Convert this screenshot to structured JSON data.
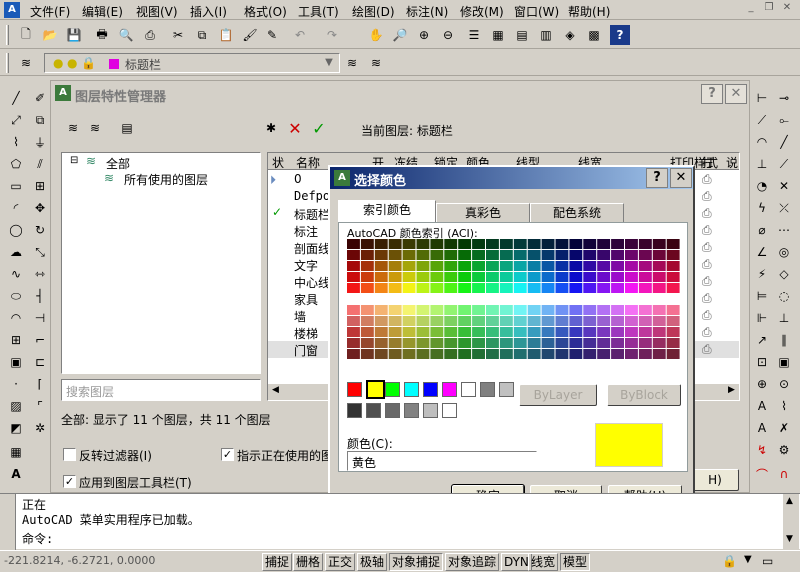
{
  "menubar": {
    "items": [
      "文件(F)",
      "编辑(E)",
      "视图(V)",
      "插入(I)",
      "格式(O)",
      "工具(T)",
      "绘图(D)",
      "标注(N)",
      "修改(M)",
      "窗口(W)",
      "帮助(H)"
    ]
  },
  "layer_toolbar": {
    "current_layer": "标题栏"
  },
  "layer_manager": {
    "title": "图层特性管理器",
    "current_layer_label": "当前图层: 标题栏",
    "tree": {
      "root": "全部",
      "child": "所有使用的图层"
    },
    "search_placeholder": "搜索图层",
    "columns": [
      "状",
      "名称",
      "开",
      "冻结",
      "锁定",
      "颜色",
      "线型",
      "线宽",
      "打印样式",
      "打",
      "说"
    ],
    "layers": [
      "0",
      "Defpoints",
      "标题栏",
      "标注",
      "剖面线",
      "文字",
      "中心线",
      "家具",
      "墙",
      "楼梯",
      "门窗"
    ],
    "status_text": "全部: 显示了 11 个图层，共 11 个图层",
    "invert_filter_label": "反转过滤器(I)",
    "show_used_label": "指示正在使用的图",
    "apply_toolbar_label": "应用到图层工具栏(T)",
    "help_fragment": "H)"
  },
  "color_dialog": {
    "title": "选择颜色",
    "tabs": [
      "索引颜色",
      "真彩色",
      "配色系统"
    ],
    "aci_label": "AutoCAD 颜色索引 (ACI):",
    "bylayer": "ByLayer",
    "byblock": "ByBlock",
    "color_label": "颜色(C):",
    "color_value": "黄色",
    "preview_color": "#ffff00",
    "ok": "确定",
    "cancel": "取消",
    "help": "帮助(H)"
  },
  "command": {
    "line1": "正在",
    "line2": "AutoCAD 菜单实用程序已加载。",
    "prompt": "命令:"
  },
  "statusbar": {
    "coords": "-221.8214, -6.2721, 0.0000",
    "buttons": [
      "捕捉",
      "栅格",
      "正交",
      "极轴",
      "对象捕捉",
      "对象追踪",
      "DYN",
      "线宽",
      "模型"
    ]
  }
}
